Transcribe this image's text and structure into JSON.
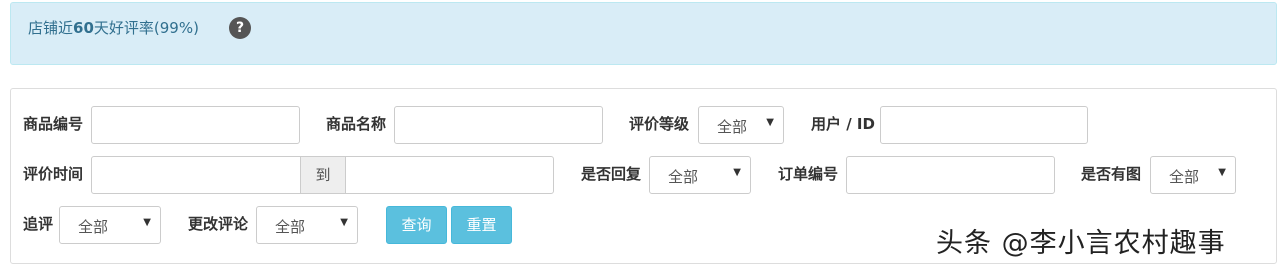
{
  "banner": {
    "prefix": "店铺近",
    "days": "60",
    "suffix": "天好评率(99%)",
    "help_icon": "?"
  },
  "filters": {
    "product_code_label": "商品编号",
    "product_code_value": "",
    "product_name_label": "商品名称",
    "product_name_value": "",
    "rating_level_label": "评价等级",
    "rating_level_value": "全部",
    "user_id_label": "用户 / ID",
    "user_id_value": "",
    "review_time_label": "评价时间",
    "review_time_start": "",
    "review_time_to": "到",
    "review_time_end": "",
    "replied_label": "是否回复",
    "replied_value": "全部",
    "order_no_label": "订单编号",
    "order_no_value": "",
    "has_image_label": "是否有图",
    "has_image_value": "全部",
    "follow_up_label": "追评",
    "follow_up_value": "全部",
    "changed_label": "更改评论",
    "changed_value": "全部"
  },
  "buttons": {
    "query": "查询",
    "reset": "重置"
  },
  "watermark": "头条 @李小言农村趣事",
  "icons": {
    "help": "question-circle-icon",
    "caret": "caret-down-icon"
  },
  "colors": {
    "banner_bg": "#d9edf7",
    "banner_text": "#31708f",
    "button": "#5bc0de"
  }
}
